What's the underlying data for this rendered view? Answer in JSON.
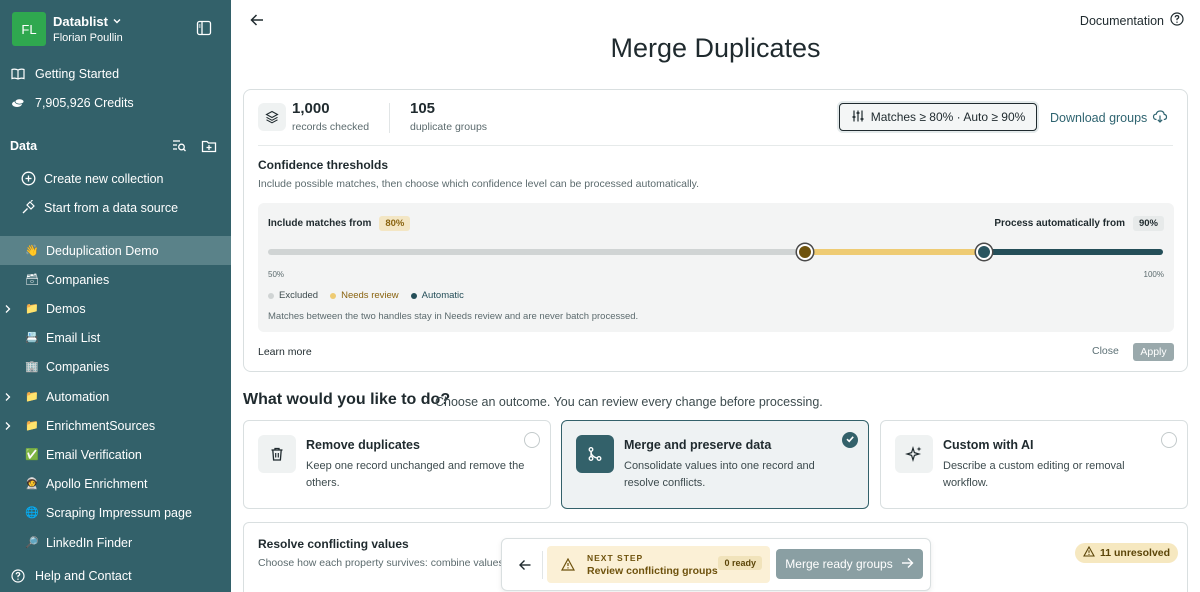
{
  "sidebar": {
    "avatar": "FL",
    "workspace_name": "Datablist",
    "user_name": "Florian Poullin",
    "getting_started": "Getting Started",
    "credits": "7,905,926 Credits",
    "data_heading": "Data",
    "create_collection": "Create new collection",
    "start_from_source": "Start from a data source",
    "collections": [
      {
        "label": "Deduplication Demo",
        "emoji": "👋",
        "selected": true
      },
      {
        "label": "Companies",
        "emoji": "🗃"
      },
      {
        "label": "Demos",
        "emoji": "📁",
        "folder": true
      },
      {
        "label": "Email List",
        "emoji": "📇"
      },
      {
        "label": "Companies",
        "emoji": "🏢"
      },
      {
        "label": "Automation",
        "emoji": "📁",
        "folder": true
      },
      {
        "label": "EnrichmentSources",
        "emoji": "📁",
        "folder": true
      },
      {
        "label": "Email Verification",
        "emoji": "✅"
      },
      {
        "label": "Apollo Enrichment",
        "emoji": "🧑‍🚀"
      },
      {
        "label": "Scraping Impressum page",
        "emoji": "🌐"
      },
      {
        "label": "LinkedIn Finder",
        "emoji": "🔎"
      }
    ],
    "help": "Help and Contact"
  },
  "header": {
    "documentation": "Documentation",
    "title": "Merge Duplicates"
  },
  "summary": {
    "records_value": "1,000",
    "records_caption": "records checked",
    "groups_value": "105",
    "groups_caption": "duplicate groups",
    "match_button": "Matches ≥ 80% · Auto ≥ 90%",
    "download": "Download groups"
  },
  "thresholds": {
    "title": "Confidence thresholds",
    "description": "Include possible matches, then choose which confidence level can be processed automatically.",
    "include_label": "Include matches from",
    "include_value": "80%",
    "auto_label": "Process automatically from",
    "auto_value": "90%",
    "slider_min_label": "50%",
    "slider_max_label": "100%",
    "slider_min": 50,
    "slider_max": 100,
    "include_threshold": 80,
    "auto_threshold": 90,
    "legend_excluded": "Excluded",
    "legend_review": "Needs review",
    "legend_auto": "Automatic",
    "note": "Matches between the two handles stay in Needs review and are never batch processed.",
    "learn_more": "Learn more",
    "close": "Close",
    "apply": "Apply"
  },
  "question": {
    "title": "What would you like to do?",
    "subtitle": "Choose an outcome. You can review every change before processing."
  },
  "options": [
    {
      "title": "Remove duplicates",
      "desc": "Keep one record unchanged and remove the others.",
      "icon": "trash-icon",
      "selected": false
    },
    {
      "title": "Merge and preserve data",
      "desc": "Consolidate values into one record and resolve conflicts.",
      "icon": "merge-icon",
      "selected": true
    },
    {
      "title": "Custom with AI",
      "desc": "Describe a custom editing or removal workflow.",
      "icon": "sparkles-icon",
      "selected": false
    }
  ],
  "resolve": {
    "title": "Resolve conflicting values",
    "desc": "Choose how each property survives: combine values,",
    "unresolved": "11 unresolved"
  },
  "floatbar": {
    "next_step_label": "NEXT STEP",
    "next_step_value": "Review conflicting groups",
    "ready": "0 ready",
    "merge_button": "Merge ready groups"
  },
  "colors": {
    "sidebar": "#33616a",
    "accent": "#33616a",
    "review": "#eecb73",
    "auto": "#244e58"
  }
}
